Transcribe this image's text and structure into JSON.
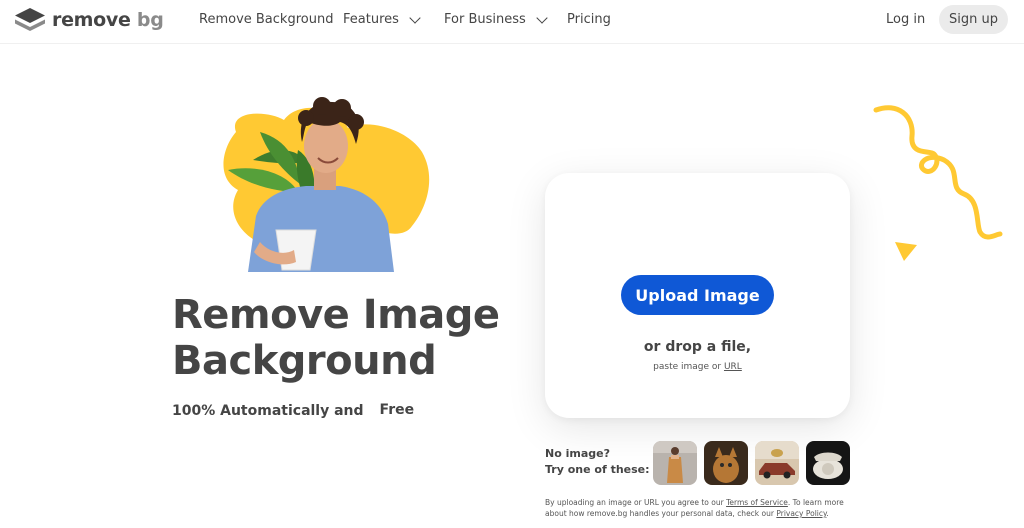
{
  "nav": {
    "brand_remove": "remove",
    "brand_bg": "bg",
    "links": [
      "Remove Background",
      "Features",
      "For Business",
      "Pricing"
    ],
    "login": "Log in",
    "signup": "Sign up"
  },
  "hero": {
    "title_line1": "Remove Image",
    "title_line2": "Background",
    "subtitle": "100% Automatically and",
    "badge": "Free"
  },
  "upload": {
    "button": "Upload Image",
    "drop": "or drop a file,",
    "paste_prefix": "paste image or ",
    "paste_link": "URL"
  },
  "samples": {
    "label_line1": "No image?",
    "label_line2": "Try one of these:",
    "items": [
      "sample-woman",
      "sample-cat",
      "sample-car",
      "sample-telephone"
    ]
  },
  "legal": {
    "part1": "By uploading an image or URL you agree to our ",
    "tos": "Terms of Service",
    "part2": ". To learn more about how remove.bg handles your personal data, check our ",
    "privacy": "Privacy Policy",
    "part3": "."
  },
  "colors": {
    "primary": "#0f58d6",
    "accent_yellow": "#ffc933",
    "text": "#454545"
  }
}
